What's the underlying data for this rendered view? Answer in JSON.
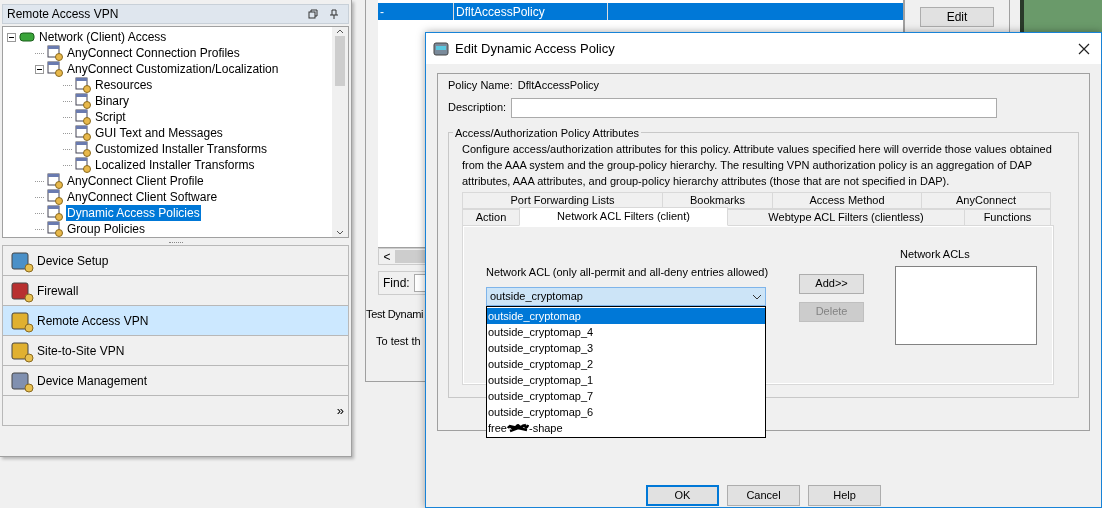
{
  "left_panel": {
    "title": "Remote Access VPN",
    "tree": [
      {
        "label": "Network (Client) Access",
        "expanded": true,
        "selected": false,
        "children": [
          {
            "label": "AnyConnect Connection Profiles",
            "selected": false
          },
          {
            "label": "AnyConnect Customization/Localization",
            "expanded": true,
            "selected": false,
            "children": [
              {
                "label": "Resources",
                "selected": false
              },
              {
                "label": "Binary",
                "selected": false
              },
              {
                "label": "Script",
                "selected": false
              },
              {
                "label": "GUI Text and Messages",
                "selected": false
              },
              {
                "label": "Customized Installer Transforms",
                "selected": false
              },
              {
                "label": "Localized Installer Transforms",
                "selected": false
              }
            ]
          },
          {
            "label": "AnyConnect Client Profile",
            "selected": false
          },
          {
            "label": "AnyConnect Client Software",
            "selected": false
          },
          {
            "label": "Dynamic Access Policies",
            "selected": true
          },
          {
            "label": "Group Policies",
            "selected": false
          }
        ]
      }
    ],
    "nav": [
      {
        "label": "Device Setup",
        "selected": false
      },
      {
        "label": "Firewall",
        "selected": false
      },
      {
        "label": "Remote Access VPN",
        "selected": true
      },
      {
        "label": "Site-to-Site VPN",
        "selected": false
      },
      {
        "label": "Device Management",
        "selected": false
      }
    ],
    "more": "»"
  },
  "background": {
    "table_row": {
      "cells": [
        "-",
        "DfltAccessPolicy"
      ],
      "selected": true
    },
    "scroll_left": "<",
    "find_label": "Find:",
    "test_title": "Test Dynami",
    "test_text": "To test th",
    "edit_button": "Edit"
  },
  "dialog": {
    "title": "Edit Dynamic Access Policy",
    "policy_name_label": "Policy Name:",
    "policy_name": "DfltAccessPolicy",
    "description_label": "Description:",
    "group_title": "Access/Authorization Policy Attributes",
    "group_text": "Configure access/authorization attributes for this policy. Attribute values specified here will override those values obtained from the AAA system and the group-policy hierarchy. The resulting VPN authorization policy is an aggregation of DAP attributes, AAA attributes, and group-policy hierarchy attributes (those that are not specified in DAP).",
    "tab_rows": [
      [
        {
          "label": "Port Forwarding Lists",
          "selected": false
        },
        {
          "label": "Bookmarks",
          "selected": false
        },
        {
          "label": "Access Method",
          "selected": false
        },
        {
          "label": "AnyConnect",
          "selected": false
        }
      ],
      [
        {
          "label": "Action",
          "selected": false
        },
        {
          "label": "Network ACL Filters (client)",
          "selected": true
        },
        {
          "label": "Webtype ACL Filters (clientless)",
          "selected": false
        },
        {
          "label": "Functions",
          "selected": false
        }
      ]
    ],
    "acl_label": "Network ACL (only all-permit and all-deny entries allowed)",
    "acl_value": "outside_cryptomap",
    "acl_options": [
      {
        "label": "outside_cryptomap",
        "selected": true
      },
      {
        "label": "outside_cryptomap_4",
        "selected": false
      },
      {
        "label": "outside_cryptomap_3",
        "selected": false
      },
      {
        "label": "outside_cryptomap_2",
        "selected": false
      },
      {
        "label": "outside_cryptomap_1",
        "selected": false
      },
      {
        "label": "outside_cryptomap_7",
        "selected": false
      },
      {
        "label": "outside_cryptomap_6",
        "selected": false
      },
      {
        "label": "free",
        "label_end": "-shape",
        "selected": false,
        "redacted": true
      }
    ],
    "add_button": {
      "label": "Add>>",
      "disabled": false
    },
    "delete_button": {
      "label": "Delete",
      "disabled": true
    },
    "acls_label": "Network ACLs",
    "buttons": [
      {
        "label": "OK",
        "default": true
      },
      {
        "label": "Cancel",
        "default": false
      },
      {
        "label": "Help",
        "default": false
      }
    ]
  }
}
